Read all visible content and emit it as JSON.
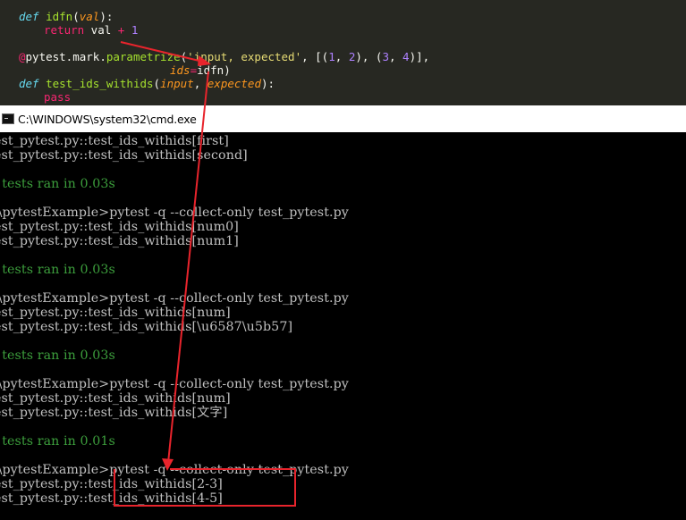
{
  "editor": {
    "lines": {
      "def_idfn": {
        "kw": "def",
        "name": "idfn",
        "open": "(",
        "param": "val",
        "close": "):"
      },
      "return_line": {
        "kw": "return",
        "expr": " val ",
        "op": "+",
        "num": " 1"
      },
      "decorator": {
        "at": "@",
        "mod": "pytest.mark.",
        "fn": "parametrize",
        "open": "(",
        "str": "'input, expected'",
        "sep1": ", [(",
        "n1": "1",
        "c1": ", ",
        "n2": "2",
        "mid": "), (",
        "n3": "3",
        "c2": ", ",
        "n4": "4",
        "end": ")],"
      },
      "ids_line": {
        "kw": "ids",
        "eq": "=",
        "val": "idfn)"
      },
      "def_test": {
        "kw": "def",
        "name": "test_ids_withids",
        "open": "(",
        "p1": "input",
        "sep": ", ",
        "p2": "expected",
        "close": "):"
      },
      "pass_line": {
        "kw": "pass"
      }
    }
  },
  "window": {
    "title": "C:\\WINDOWS\\system32\\cmd.exe"
  },
  "console": {
    "lines": [
      {
        "text": "est_pytest.py::test_ids_withids[first]",
        "green": false
      },
      {
        "text": "est_pytest.py::test_ids_withids[second]",
        "green": false
      },
      {
        "text": "",
        "green": false
      },
      {
        "text": "  tests ran in 0.03s",
        "green": true
      },
      {
        "text": "",
        "green": false
      },
      {
        "text": " \\pytestExample>pytest -q --collect-only test_pytest.py",
        "green": false
      },
      {
        "text": "est_pytest.py::test_ids_withids[num0]",
        "green": false
      },
      {
        "text": "est_pytest.py::test_ids_withids[num1]",
        "green": false
      },
      {
        "text": "",
        "green": false
      },
      {
        "text": "  tests ran in 0.03s",
        "green": true
      },
      {
        "text": "",
        "green": false
      },
      {
        "text": " \\pytestExample>pytest -q --collect-only test_pytest.py",
        "green": false
      },
      {
        "text": "est_pytest.py::test_ids_withids[num]",
        "green": false
      },
      {
        "text": "est_pytest.py::test_ids_withids[\\u6587\\u5b57]",
        "green": false
      },
      {
        "text": "",
        "green": false
      },
      {
        "text": "  tests ran in 0.03s",
        "green": true
      },
      {
        "text": "",
        "green": false
      },
      {
        "text": " \\pytestExample>pytest -q --collect-only test_pytest.py",
        "green": false
      },
      {
        "text": "est_pytest.py::test_ids_withids[num]",
        "green": false
      },
      {
        "text": "est_pytest.py::test_ids_withids[文字]",
        "green": false
      },
      {
        "text": "",
        "green": false
      },
      {
        "text": "  tests ran in 0.01s",
        "green": true
      },
      {
        "text": "",
        "green": false
      },
      {
        "text": " \\pytestExample>pytest -q --collect-only test_pytest.py",
        "green": false
      },
      {
        "text": "est_pytest.py::test_ids_withids[2-3]",
        "green": false
      },
      {
        "text": "est_pytest.py::test_ids_withids[4-5]",
        "green": false
      }
    ]
  },
  "annotation_color": "#e8242c"
}
